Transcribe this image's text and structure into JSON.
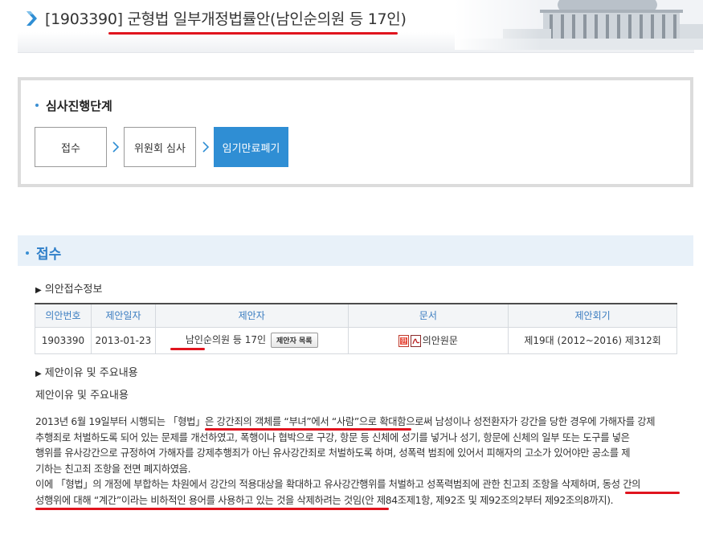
{
  "header": {
    "title": "[1903390] 군형법 일부개정법률안(남인순의원 등 17인)"
  },
  "progress": {
    "heading": "심사진행단계",
    "steps": [
      {
        "label": "접수",
        "active": false
      },
      {
        "label": "위원회 심사",
        "active": false
      },
      {
        "label": "임기만료폐기",
        "active": true
      }
    ]
  },
  "section": {
    "heading": "접수"
  },
  "bill_info": {
    "subtitle": "의안접수정보",
    "columns": [
      "의안번호",
      "제안일자",
      "제안자",
      "문서",
      "제안회기"
    ],
    "row": {
      "bill_no": "1903390",
      "date": "2013-01-23",
      "proposer": "남인순의원 등 17인",
      "proposer_list_button": "제안자 목록",
      "document": "의안원문",
      "session": "제19대 (2012~2016) 제312회"
    }
  },
  "reason": {
    "subtitle": "제안이유 및 주요내용",
    "label": "제안이유 및 주요내용",
    "lines": [
      "2013년 6월 19일부터 시행되는 「형법」은 강간죄의 객체를 “부녀”에서 “사람”으로 확대함으로써 남성이나 성전환자가 강간을 당한 경우에 가해자를 강제",
      "추행죄로 처벌하도록 되어 있는 문제를 개선하였고, 폭행이나 협박으로 구강, 항문 등 신체에 성기를 넣거나 성기, 항문에 신체의 일부 또는 도구를 넣은",
      "행위를 유사강간으로 규정하여 가해자를 강제추행죄가 아닌 유사강간죄로 처벌하도록 하며, 성폭력 범죄에 있어서 피해자의 고소가 있어야만 공소를 제",
      "기하는 친고죄 조항을 전면 폐지하였음.",
      "이에 「형법」의 개정에 부합하는 차원에서 강간의 적용대상을 확대하고 유사강간행위를 처벌하고 성폭력범죄에 관한 친고죄 조항을 삭제하며, 동성 간의",
      "성행위에 대해 “계간”이라는 비하적인 용어를 사용하고 있는 것을 삭제하려는 것임(안 제84조제1항, 제92조 및 제92조의2부터 제92조의8까지)."
    ]
  },
  "colors": {
    "accent": "#2f8ed4",
    "underline": "#e0141e",
    "section_bg": "#e8f1f9"
  }
}
